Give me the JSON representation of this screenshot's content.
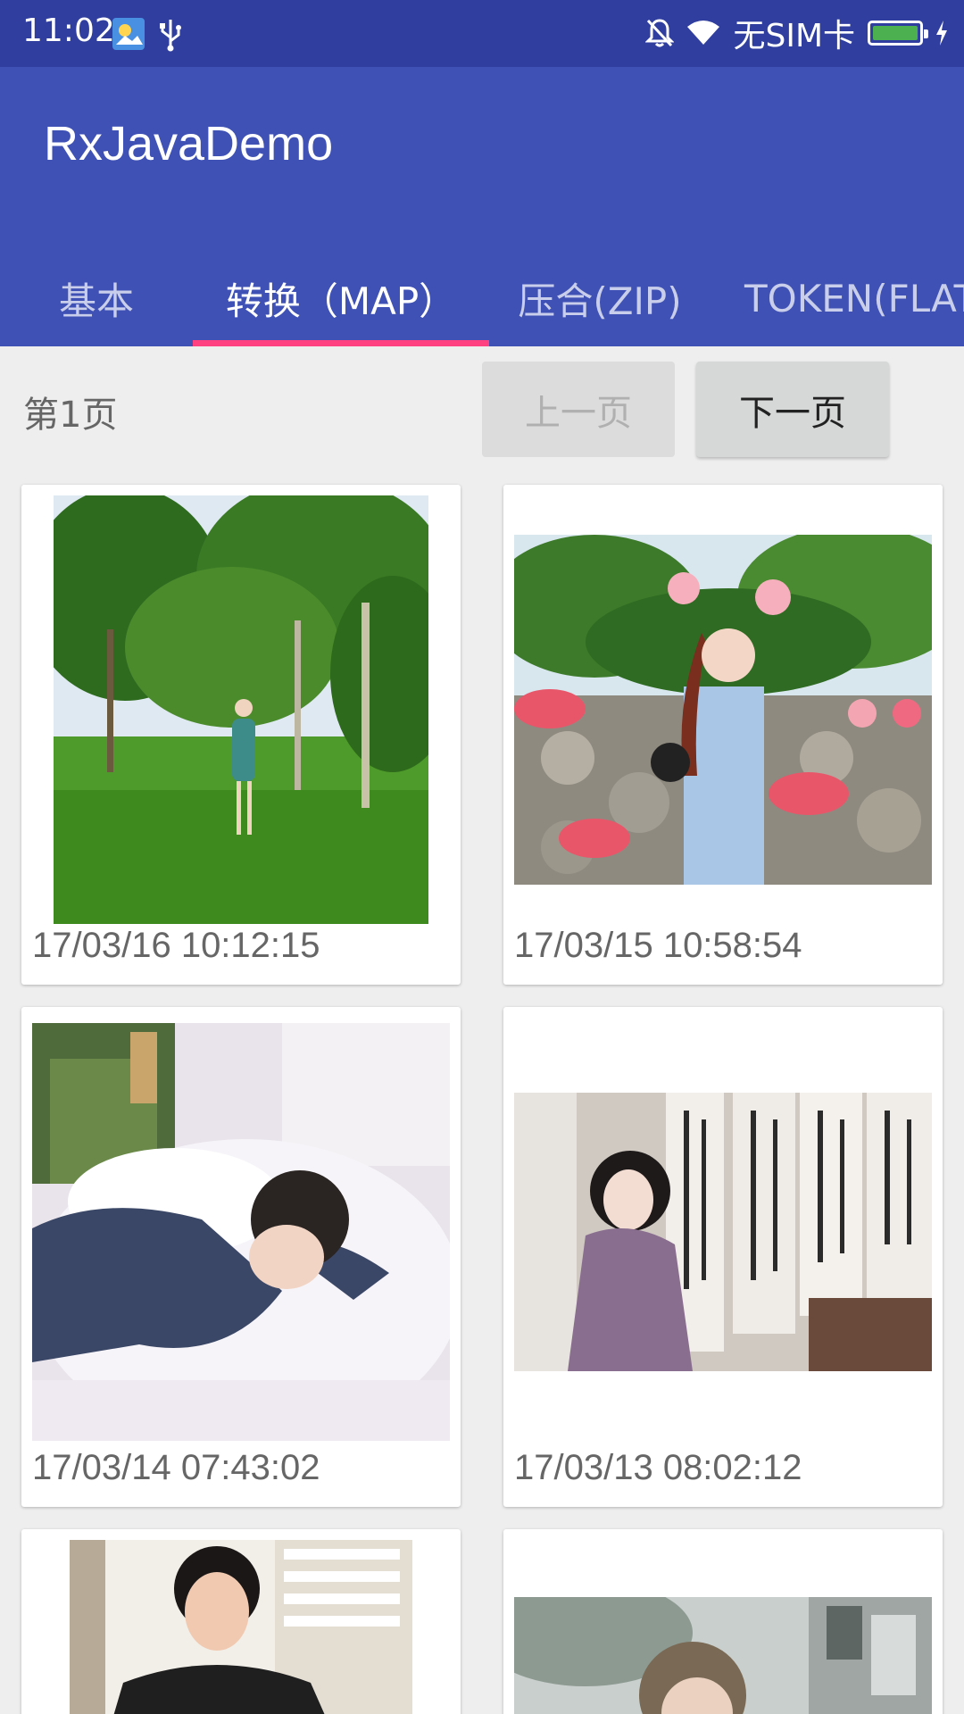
{
  "status_bar": {
    "time": "11:02",
    "carrier": "无SIM卡",
    "icons": [
      "image-notification-icon",
      "usb-icon",
      "notifications-off-icon",
      "wifi-icon",
      "battery-icon",
      "charging-icon"
    ]
  },
  "app_bar": {
    "title": "RxJavaDemo"
  },
  "tabs": [
    {
      "label": "基本",
      "active": false
    },
    {
      "label": "转换（MAP）",
      "active": true
    },
    {
      "label": "压合(ZIP)",
      "active": false
    },
    {
      "label": "TOKEN(FLAT",
      "active": false
    }
  ],
  "pager": {
    "page_label": "第1页",
    "prev_label": "上一页",
    "next_label": "下一页",
    "prev_enabled": false
  },
  "photos": [
    {
      "date": "17/03/16 10:12:15",
      "description_icon": "park-photo"
    },
    {
      "date": "17/03/15 10:58:54",
      "description_icon": "stone-wall-photo"
    },
    {
      "date": "17/03/14 07:43:02",
      "description_icon": "sleeping-photo"
    },
    {
      "date": "17/03/13 08:02:12",
      "description_icon": "calligraphy-photo"
    },
    {
      "date": "",
      "description_icon": "portrait-photo"
    },
    {
      "date": "",
      "description_icon": "street-photo"
    }
  ],
  "colors": {
    "primary": "#3f51b5",
    "primary_dark": "#303f9f",
    "accent": "#ff4081",
    "background": "#eeeeee"
  }
}
